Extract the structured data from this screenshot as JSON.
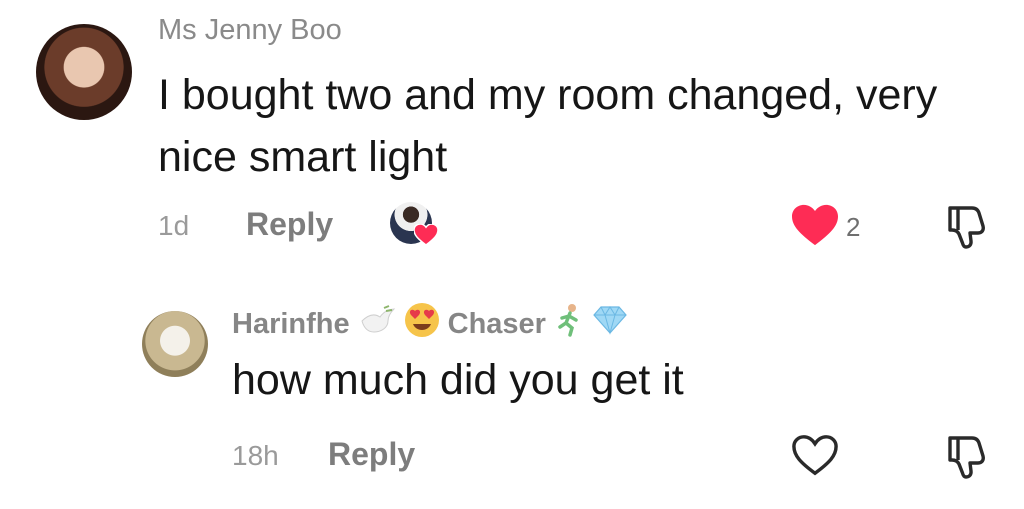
{
  "comments": [
    {
      "author": "Ms Jenny Boo",
      "text": "I bought two and my room changed, very nice smart light",
      "time": "1d",
      "reply_label": "Reply",
      "liked_by_creator": true,
      "liked": true,
      "like_count": "2"
    },
    {
      "author_part1": "Harinfhe",
      "author_part2": "Chaser",
      "text": "how much did you get it",
      "time": "18h",
      "reply_label": "Reply",
      "liked": false
    }
  ],
  "colors": {
    "like_red": "#fe2c55",
    "meta_gray": "#8a8a8a",
    "text_dark": "#161616"
  },
  "icons": [
    "heart-icon",
    "dislike-icon",
    "dove-emoji",
    "heart-eyes-emoji",
    "runner-emoji",
    "diamond-emoji"
  ]
}
